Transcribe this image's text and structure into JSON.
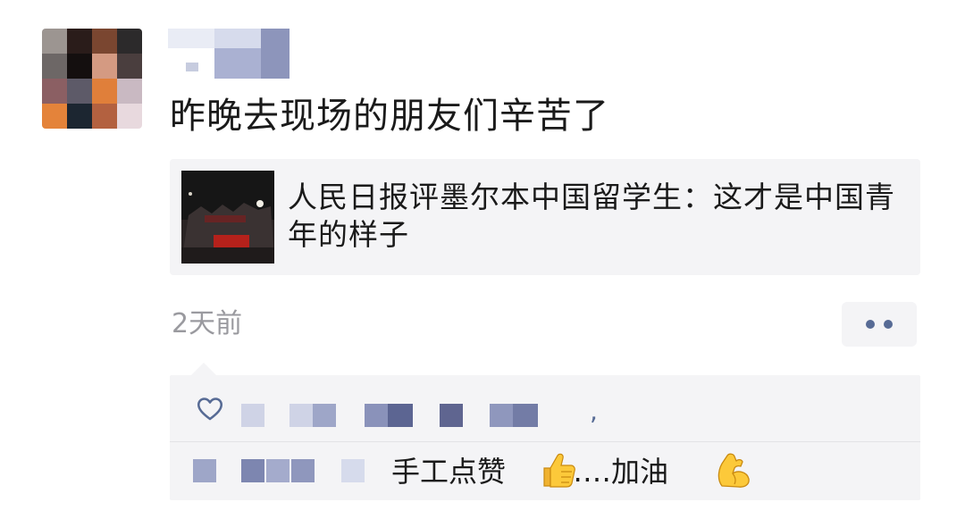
{
  "post": {
    "text": "昨晚去现场的朋友们辛苦了",
    "link_title": "人民日报评墨尔本中国留学生：这才是中国青年的样子",
    "timestamp": "2天前"
  },
  "icons": {
    "more": "more-dots-icon",
    "like": "heart-outline-icon",
    "thumbs_up": "thumbs-up-emoji",
    "flexed_biceps": "flexed-biceps-emoji"
  },
  "likes": {
    "separator": ","
  },
  "comment": {
    "text_before_emoji": "手工点赞",
    "text_between": "……加油"
  },
  "colors": {
    "link_blue": "#576b95",
    "card_background": "#f4f4f6",
    "timestamp_gray": "#9a9a9f"
  }
}
